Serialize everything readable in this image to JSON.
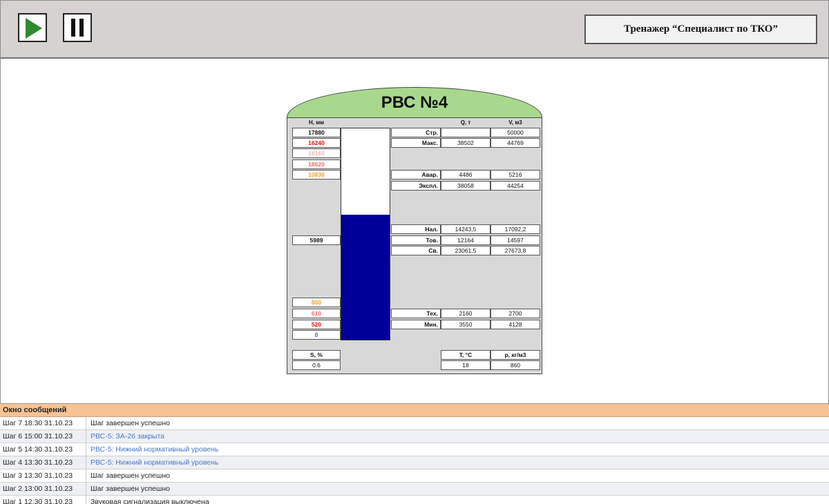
{
  "toolbar": {
    "play_icon": "play-icon",
    "pause_icon": "pause-icon",
    "title": "Тренажер “Специалист по ТКО”"
  },
  "tank": {
    "title": "РВС №4",
    "headers": {
      "h": "Н, мм",
      "q": "Q, т",
      "v": "V, м3"
    },
    "level_fraction": 0.59,
    "level_color": "#000099",
    "h_values": [
      {
        "value": "17880",
        "color": "#111111"
      },
      {
        "value": "16240",
        "color": "#e01010"
      },
      {
        "value": "16160",
        "color": "#f0b8b8"
      },
      {
        "value": "18620",
        "color": "#f06a6a"
      },
      {
        "value": "10830",
        "color": "#f0a020"
      },
      {
        "value": "5989",
        "color": "#111111"
      },
      {
        "value": "800",
        "color": "#f0a020"
      },
      {
        "value": "610",
        "color": "#f06a6a"
      },
      {
        "value": "520",
        "color": "#e01010"
      },
      {
        "value": "0",
        "color": "#3a6ad0"
      }
    ],
    "rows": [
      {
        "label": "Стр.",
        "q": "",
        "v": "50000"
      },
      {
        "label": "Макс.",
        "q": "38502",
        "v": "44769"
      },
      {
        "label": "Авар.",
        "q": "4486",
        "v": "5216"
      },
      {
        "label": "Экспл.",
        "q": "38058",
        "v": "44254"
      },
      {
        "label": "Нал.",
        "q": "14243,5",
        "v": "17092,2"
      },
      {
        "label": "Тов.",
        "q": "12164",
        "v": "14597"
      },
      {
        "label": "Св.",
        "q": "23061,5",
        "v": "27673,8"
      },
      {
        "label": "Тех.",
        "q": "2160",
        "v": "2700"
      },
      {
        "label": "Мин.",
        "q": "3550",
        "v": "4128"
      }
    ],
    "bottom": {
      "s_label": "S, %",
      "s_value": "0.6",
      "t_label": "T, °C",
      "t_value": "18",
      "p_label": "р, кг/м3",
      "p_value": "860"
    }
  },
  "messages": {
    "title": "Окно сообщений",
    "items": [
      {
        "step": "Шаг 7 18:30 31.10.23",
        "text": "Шаг завершен успешно",
        "blue": false
      },
      {
        "step": "Шаг 6 15:00 31.10.23",
        "text": "РВС-5: ЗА-26 закрыта",
        "blue": true
      },
      {
        "step": "Шаг 5 14:30 31.10.23",
        "text": "РВС-5: Нижний нормативный уровень",
        "blue": true
      },
      {
        "step": "Шаг 4 13:30 31.10.23",
        "text": "РВС-5: Нижний нормативный уровень",
        "blue": true
      },
      {
        "step": "Шаг 3 13:30 31.10.23",
        "text": "Шаг завершен успешно",
        "blue": false
      },
      {
        "step": "Шаг 2 13:00 31.10.23",
        "text": "Шаг завершен успешно",
        "blue": false
      },
      {
        "step": "Шаг 1 12:30 31.10.23",
        "text": "Звуковая сигнализация выключена",
        "blue": false
      }
    ]
  }
}
